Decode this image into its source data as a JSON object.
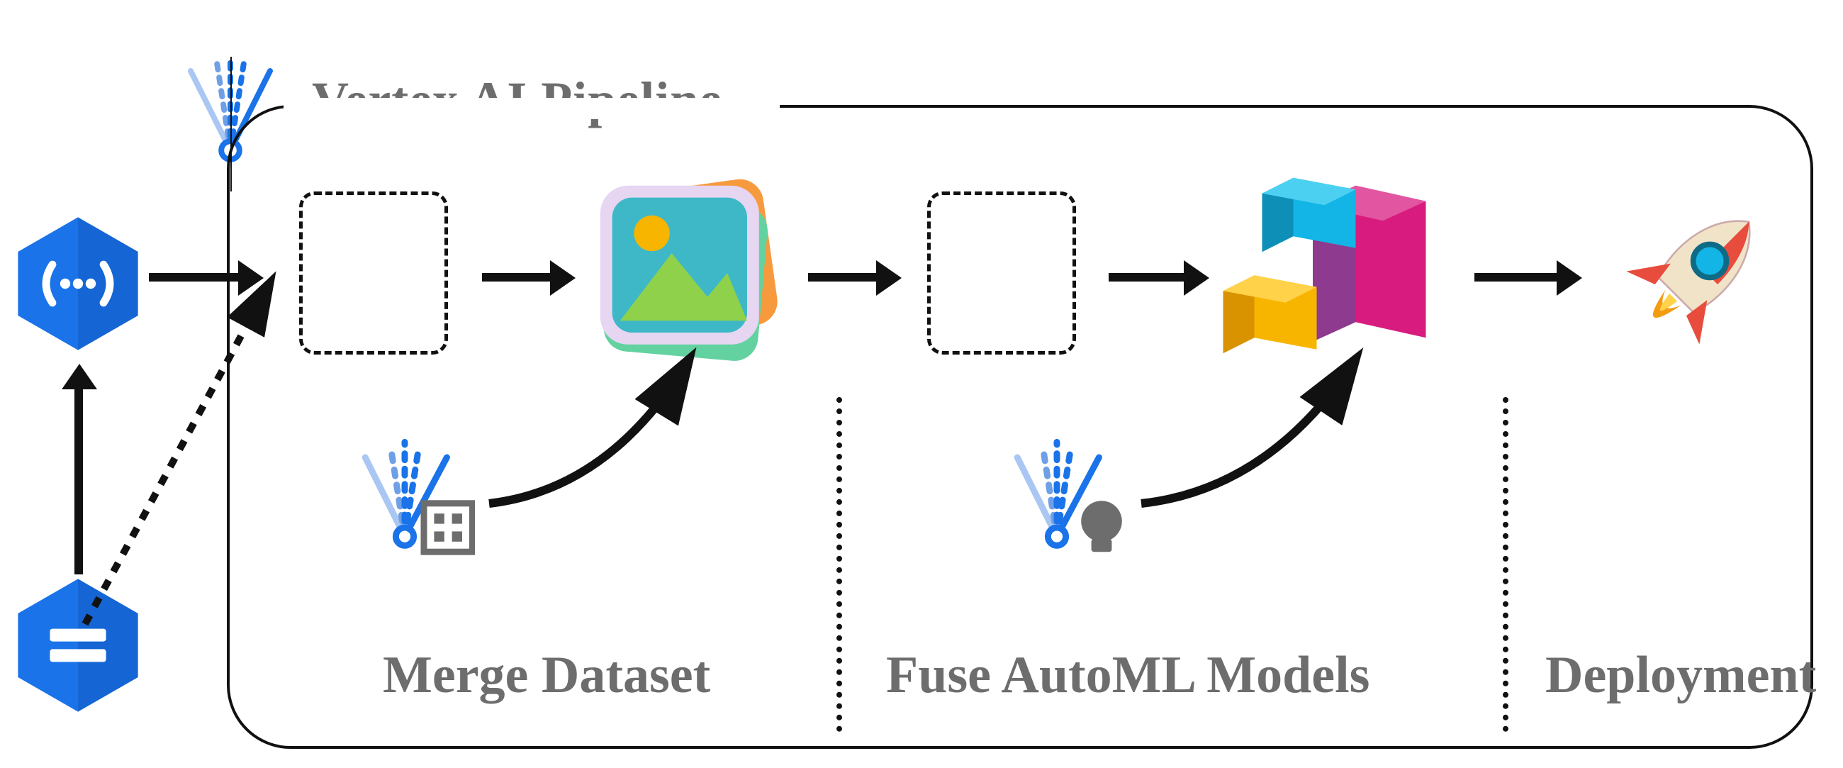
{
  "title": "Vertex AI Pipeline",
  "sections": {
    "merge": "Merge Dataset",
    "fuse": "Fuse AutoML Models",
    "deploy": "Deployment"
  },
  "colors": {
    "gcp_blue": "#1a73e8",
    "gcp_blue_dark": "#1259c3",
    "text_grey": "#6d6d6d",
    "cube_yellow": "#f7b500",
    "cube_cyan": "#12b5e5",
    "cube_magenta": "#d81b7f",
    "cube_purple": "#8e3a8e",
    "image_green": "#8fd14a",
    "image_teal": "#3eb8c7",
    "rocket_red": "#e74c3c",
    "rocket_tan": "#f1e3c8",
    "flame_orange": "#f39c12"
  }
}
